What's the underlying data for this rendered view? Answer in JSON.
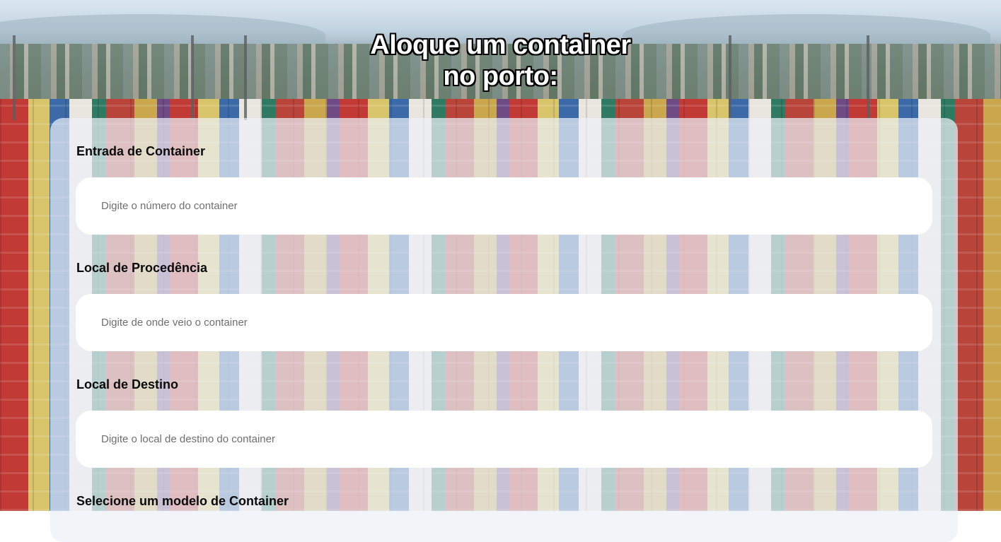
{
  "page": {
    "title_line1": "Aloque um container",
    "title_line2": "no porto:"
  },
  "form": {
    "container_number": {
      "label": "Entrada de Container",
      "placeholder": "Digite o número do container",
      "value": ""
    },
    "origin": {
      "label": "Local de Procedência",
      "placeholder": "Digite de onde veio o container",
      "value": ""
    },
    "destination": {
      "label": "Local de Destino",
      "placeholder": "Digite o local de destino do container",
      "value": ""
    },
    "model": {
      "label": "Selecione um modelo de Container"
    }
  },
  "colors": {
    "panel": "#ebf0f6",
    "input_bg": "#ffffff",
    "label_text": "#0a0a0a",
    "title_text": "#ffffff",
    "title_outline": "#000000"
  }
}
